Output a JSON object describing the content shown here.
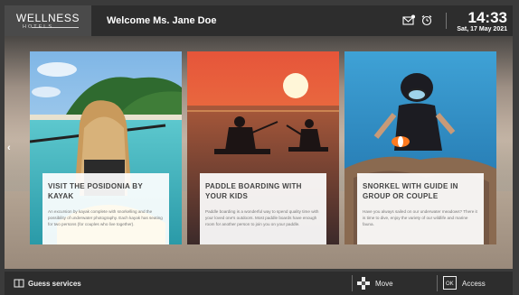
{
  "header": {
    "logo_main": "WELLNESS",
    "logo_sub": "HOTELS",
    "welcome": "Welcome Ms. Jane Doe",
    "icons": [
      "mail-icon",
      "alarm-clock-icon"
    ],
    "time": "14:33",
    "date": "Sat, 17 May 2021"
  },
  "cards": [
    {
      "title": "VISIT THE POSIDONIA BY KAYAK",
      "description": "An excursion by kayak complete with snorkelling and the possibility of underwater photography. Each kayak has seating for two persons (for couples who live together)."
    },
    {
      "title": "PADDLE BOARDING WITH YOUR KIDS",
      "description": "Paddle boarding is a wonderful way to spend quality time with your loved one's outdoors. Most paddle boards have enough room for another person to join you on your paddle."
    },
    {
      "title": "SNORKEL WITH GUIDE IN GROUP OR COUPLE",
      "description": "Have you always sailed on our underwater meadows? There it is time to dive, enjoy the variety of our wildlife and marine fauna."
    }
  ],
  "nav": {
    "left_arrow": "‹"
  },
  "footer": {
    "services_label": "Guess services",
    "move_label": "Move",
    "access_label": "Access",
    "icons": [
      "book-icon",
      "dpad-icon",
      "ok-button-icon"
    ]
  },
  "colors": {
    "header_bg": "#2d2d2d",
    "logo_bg": "#4a4a4a",
    "card_caption_bg": "#ffffff"
  }
}
